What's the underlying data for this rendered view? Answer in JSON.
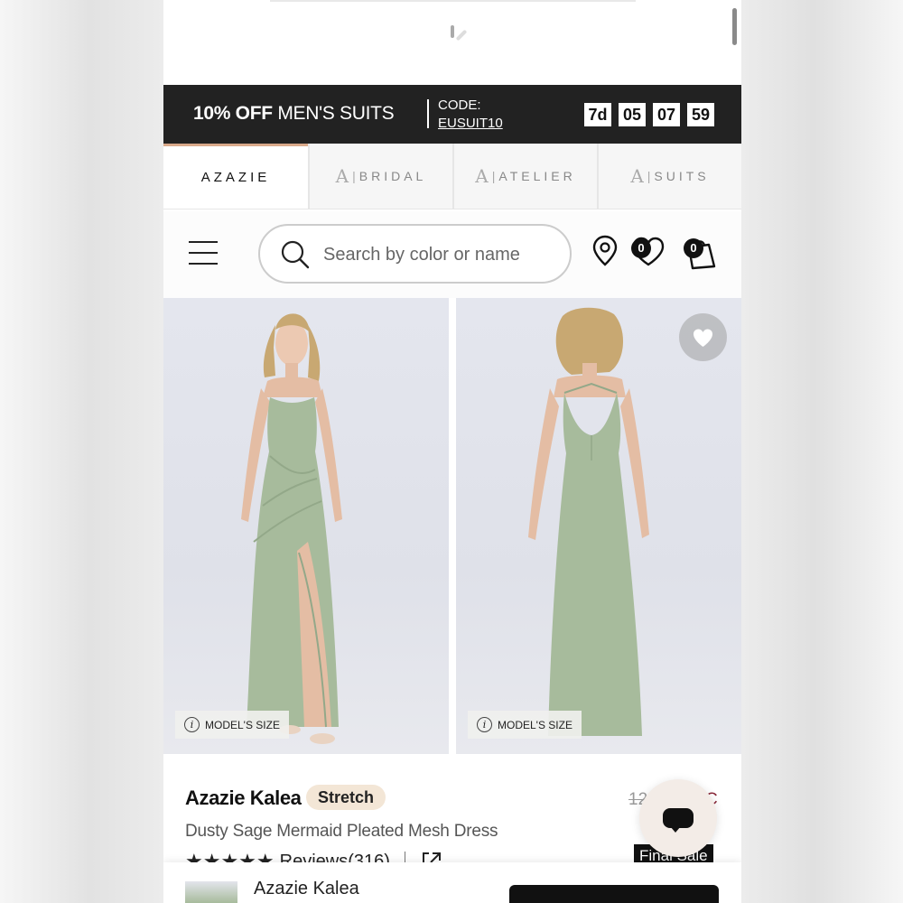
{
  "promo": {
    "bold_text": "10% OFF",
    "text": "MEN'S SUITS",
    "code_label": "CODE:",
    "code_value": "EUSUIT10",
    "timer": [
      "7d",
      "05",
      "07",
      "59"
    ]
  },
  "tabs": [
    {
      "label": "AZAZIE"
    },
    {
      "label": "BRIDAL"
    },
    {
      "label": "ATELIER"
    },
    {
      "label": "SUITS"
    }
  ],
  "search": {
    "placeholder": "Search by color or name"
  },
  "header": {
    "wishlist_count": "0",
    "cart_count": "0"
  },
  "gallery": {
    "model_size_label": "MODEL'S SIZE"
  },
  "product": {
    "brand": "Azazie Kalea",
    "tag": "Stretch",
    "name": "Dusty Sage Mermaid Pleated Mesh Dress",
    "stars": "★★★★★",
    "reviews": "Reviews(316)",
    "price_old": "12",
    "price_accent": "C",
    "final_sale": "Final Sale"
  },
  "sticky": {
    "name": "Azazie Kalea"
  },
  "colors": {
    "accent": "#d9a98a",
    "promo_bg": "#222222",
    "dress": "#a7bb9c",
    "stretch_tag": "#f3e6d6"
  }
}
